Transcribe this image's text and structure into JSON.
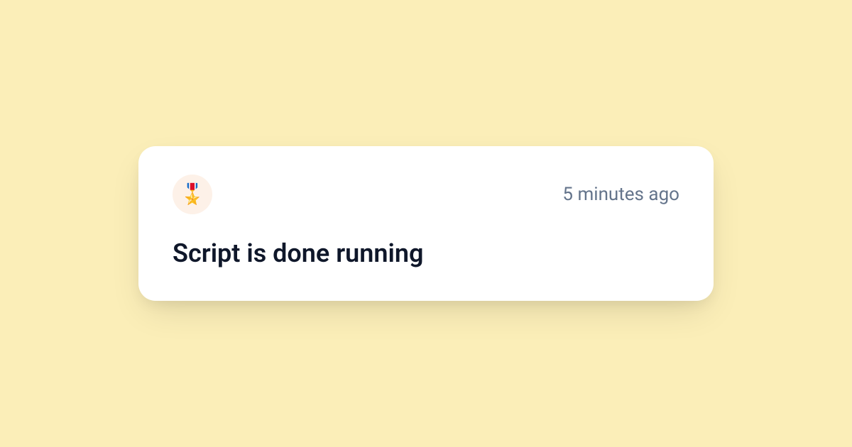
{
  "notification": {
    "icon": "🎖️",
    "timestamp": "5 minutes ago",
    "message": "Script is done running"
  },
  "colors": {
    "background": "#fbeeb8",
    "card_background": "#ffffff",
    "icon_badge_background": "#fdf1e8",
    "timestamp_text": "#64748b",
    "message_text": "#0f172a"
  }
}
